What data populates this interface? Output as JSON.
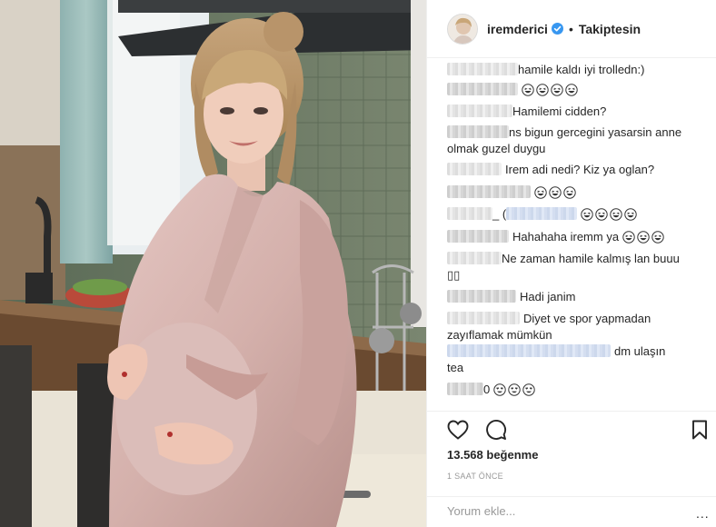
{
  "post": {
    "username": "iremderici",
    "separator": "•",
    "follow_status": "Takiptesin",
    "likes": "13.568 beğenme",
    "time_ago": "1 SAAT ÖNCE",
    "comment_placeholder": "Yorum ekle...",
    "more_label": "...",
    "image_alt": "Photo of a pregnant woman in a pink robe standing in a kitchen"
  },
  "comments": [
    {
      "text": "hamile kaldı iyi trolledn:)"
    },
    {
      "text": "",
      "emoji_count": 4,
      "emoji": "grinning-squint-face"
    },
    {
      "text": "Hamilemi cidden?"
    },
    {
      "text": "ns bigun gercegini yasarsin anne",
      "text2": "olmak guzel duygu"
    },
    {
      "text": "Irem adi nedi? Kiz ya oglan?"
    },
    {
      "text": "",
      "emoji_count": 3,
      "emoji": "grinning-squint-face"
    },
    {
      "text": "_ (",
      "emoji_count": 4,
      "emoji": "grinning-squint-face"
    },
    {
      "text": "Hahahaha iremm ya",
      "emoji_count": 3,
      "emoji": "grinning-squint-face"
    },
    {
      "text": "Ne zaman hamile kalmış lan buuu",
      "text2": "▯▯"
    },
    {
      "text": "Hadi janim"
    },
    {
      "text": "Diyet ve spor yapmadan",
      "text2": "zayıflamak mümkün"
    },
    {
      "text": "dm ulaşın",
      "text2": "tea"
    },
    {
      "text": "0",
      "emoji_count": 3,
      "emoji": "heart-eyes-face"
    }
  ],
  "colors": {
    "text": "#262626",
    "muted": "#999999",
    "border": "#efefef",
    "verified": "#3897f0",
    "robe": "#d9b8b4"
  }
}
